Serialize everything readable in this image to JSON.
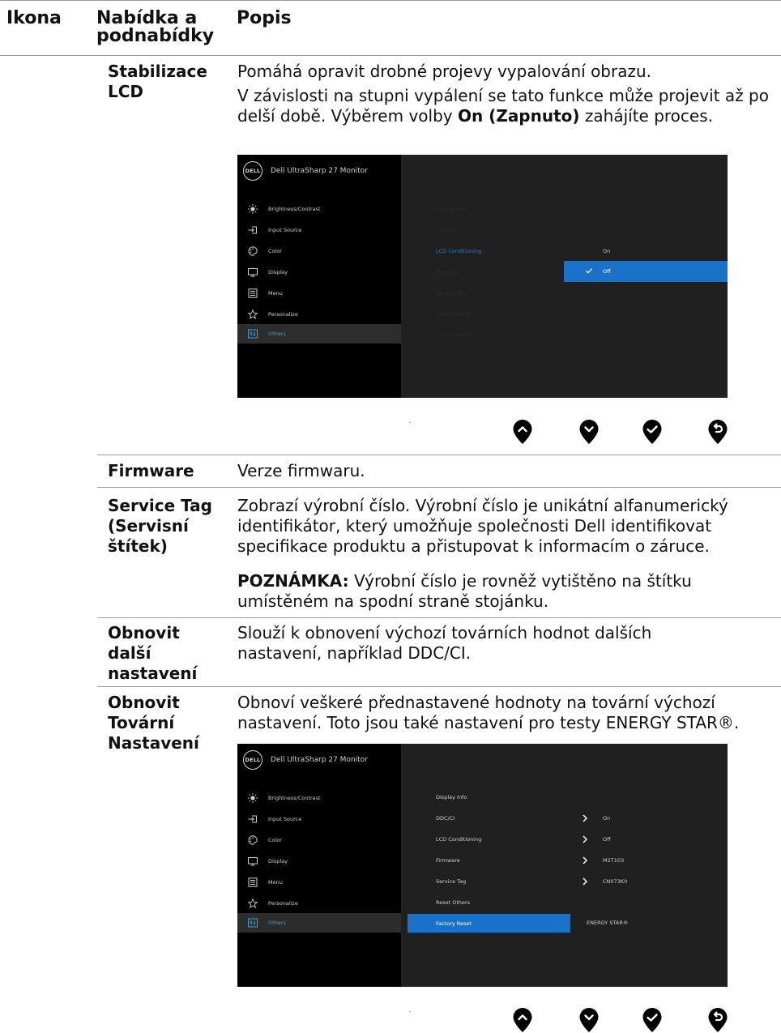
{
  "header": {
    "col1": "Ikona",
    "col2": "Nabídka a podnabídky",
    "col3": "Popis"
  },
  "rows": {
    "lcd": {
      "label": "Stabilizace LCD",
      "desc1": "Pomáhá opravit drobné projevy vypalování obrazu.",
      "desc2_pre": "V závislosti na stupni vypálení se tato funkce může projevit až po delší době. Výběrem volby ",
      "desc2_bold": "On (Zapnuto)",
      "desc2_post": " zahájíte proces."
    },
    "firmware": {
      "label": "Firmware",
      "desc": "Verze firmwaru."
    },
    "service": {
      "label": "Service Tag (Servisní štítek)",
      "desc": "Zobrazí výrobní číslo. Výrobní číslo je unikátní alfanumerický identifikátor, který umožňuje společnosti Dell identifikovat specifikace produktu a přistupovat k informacím o záruce.",
      "note_bold": "POZNÁMKA:",
      "note": " Výrobní číslo je rovněž vytištěno na štítku umístěném na spodní straně stojánku."
    },
    "reset_others": {
      "label": "Obnovit další nastavení",
      "desc": "Slouží k obnovení výchozí továrních hodnot dalších nastavení, například DDC/CI."
    },
    "factory": {
      "label": "Obnovit Tovární Nastavení",
      "desc": "Obnoví veškeré přednastavené hodnoty na tovární výchozí nastavení. Toto jsou také nastavení pro testy ENERGY STAR®."
    }
  },
  "osd": {
    "logo": "DELL",
    "title": "Dell UltraSharp 27 Monitor",
    "menu": [
      "Brightness/Contrast",
      "Input Source",
      "Color",
      "Display",
      "Menu",
      "Personalize",
      "Others"
    ],
    "selected_menu": "Others",
    "submenu": [
      "Display Info",
      "DDC/CI",
      "LCD Conditioning",
      "Firmware",
      "Service Tag",
      "Reset Others",
      "Factory Reset"
    ],
    "first": {
      "active_item": "LCD Conditioning",
      "options": [
        "On",
        "Off"
      ],
      "checked_option": "Off"
    },
    "second": {
      "selected_item": "Factory Reset",
      "values": {
        "ddc": "On",
        "lcd": "Off",
        "firmware": "M2T103",
        "service": "CN073K0",
        "factory": "ENERGY STAR®"
      }
    }
  },
  "buttons": [
    "up-button",
    "down-button",
    "ok-button",
    "back-button"
  ],
  "colors": {
    "osd_selection": "#1a72c8",
    "osd_selected_menu_text": "#3a9ee2",
    "osd_background": "#202020"
  }
}
